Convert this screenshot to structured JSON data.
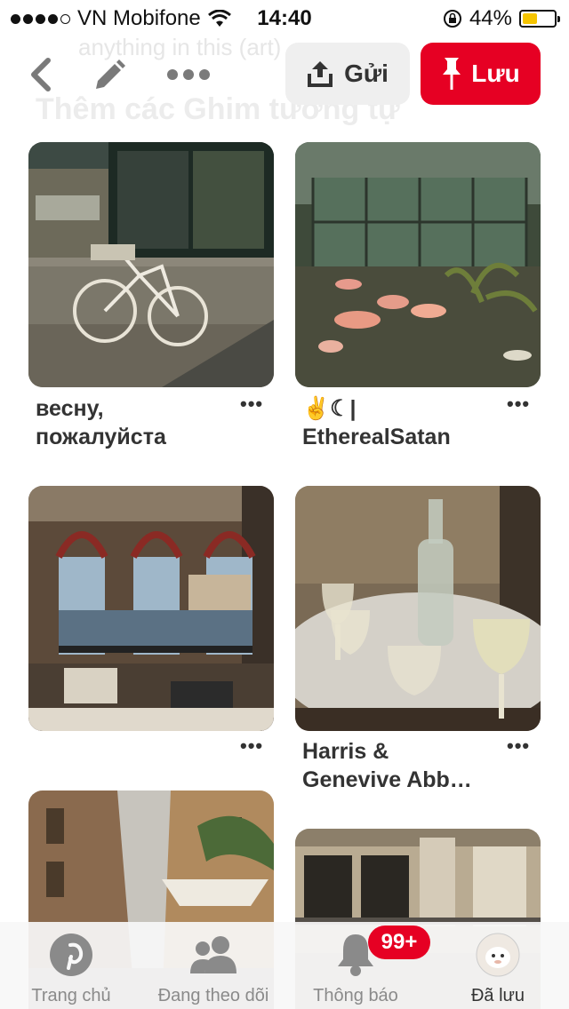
{
  "status_bar": {
    "carrier": "VN Mobifone",
    "time": "14:40",
    "battery": "44%",
    "battery_level": 0.44
  },
  "background_text": {
    "line1": "anything in this (art)",
    "line2": "Thêm các Ghim tương tự"
  },
  "toolbar": {
    "back_icon": "chevron-left-icon",
    "edit_icon": "pencil-icon",
    "more_icon": "ellipsis-icon",
    "send_label": "Gửi",
    "save_label": "Lưu",
    "accent_color": "#e60023"
  },
  "pins": [
    {
      "title": "весну, пожалуйста",
      "line1": "весну,",
      "line2": "пожалуйста",
      "image": "bookstore with bicycle"
    },
    {
      "title": "✌☾|",
      "line1": "✌☾|",
      "line2": "EtherealSatan",
      "image": "flamingos in greenhouse"
    },
    {
      "title": "",
      "image": "window view over river"
    },
    {
      "title": "Harris & Genevive Abb…",
      "line1": "Harris &",
      "line2": "Genevive Abb…",
      "image": "wine glasses on table"
    },
    {
      "title": "",
      "image": "narrow street with restaurant awning"
    },
    {
      "title": "",
      "image": "old building facade"
    }
  ],
  "more_label": "•••",
  "bottom_nav": {
    "home": "Trang chủ",
    "following": "Đang theo dõi",
    "notifications": "Thông báo",
    "notifications_badge": "99+",
    "saved": "Đã lưu"
  }
}
